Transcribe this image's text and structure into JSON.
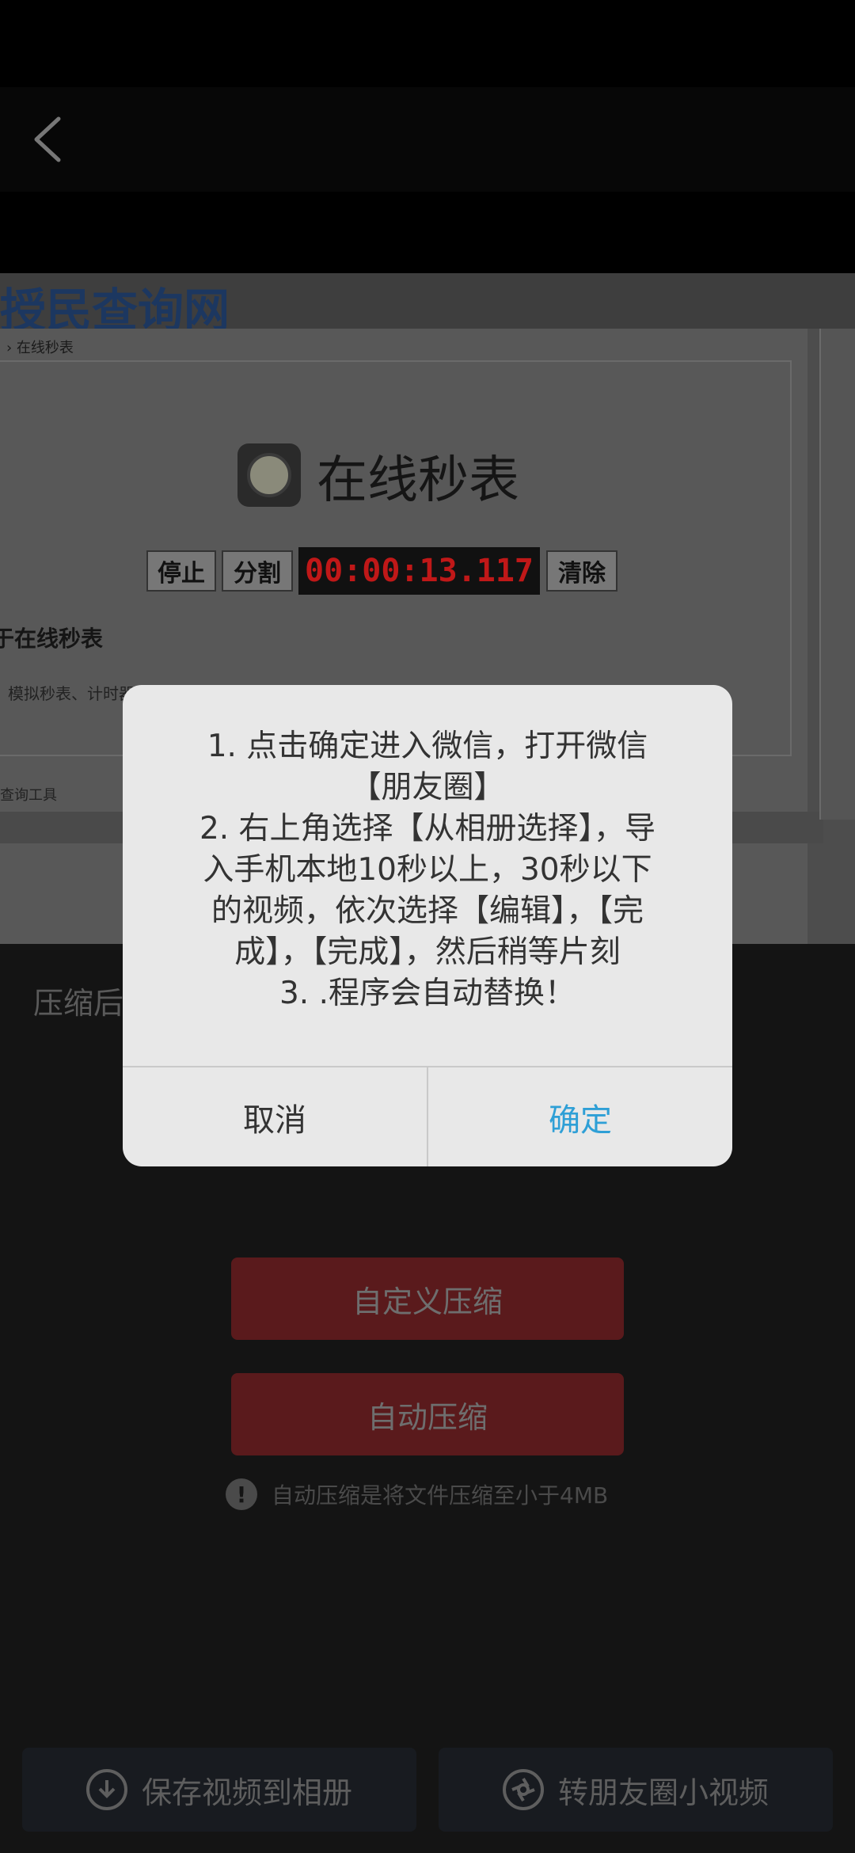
{
  "header": {
    "back_icon": "chevron-left-icon"
  },
  "video_preview": {
    "crumb": "› 在线秒表",
    "page_title": "在线秒表",
    "buttons": [
      "停止",
      "分割"
    ],
    "timer": "00:00:13.117",
    "clear": "清除",
    "subtitle": "于在线秒表",
    "desc": "模拟秒表、计时器的原理，方便您计算时间。",
    "footer": "查询工具"
  },
  "main": {
    "compress_label_prefix": "压缩后",
    "custom_compress": "自定义压缩",
    "auto_compress": "自动压缩",
    "hint": "自动压缩是将文件压缩至小于4MB",
    "save_video": "保存视频到相册",
    "share_moments": "转朋友圈小视频"
  },
  "dialog": {
    "lines": [
      "1. 点击确定进入微信，打开微信",
      "【朋友圈】",
      "2. 右上角选择【从相册选择】，导",
      "入手机本地10秒以上，30秒以下",
      "的视频，依次选择【编辑】，【完",
      "成】，【完成】，然后稍等片刻",
      "3. .程序会自动替换！"
    ],
    "cancel": "取消",
    "confirm": "确定"
  },
  "colors": {
    "confirm_accent": "#2e9fd6",
    "button_red": "#5a1a1c",
    "dialog_bg": "#e8e8e8"
  }
}
